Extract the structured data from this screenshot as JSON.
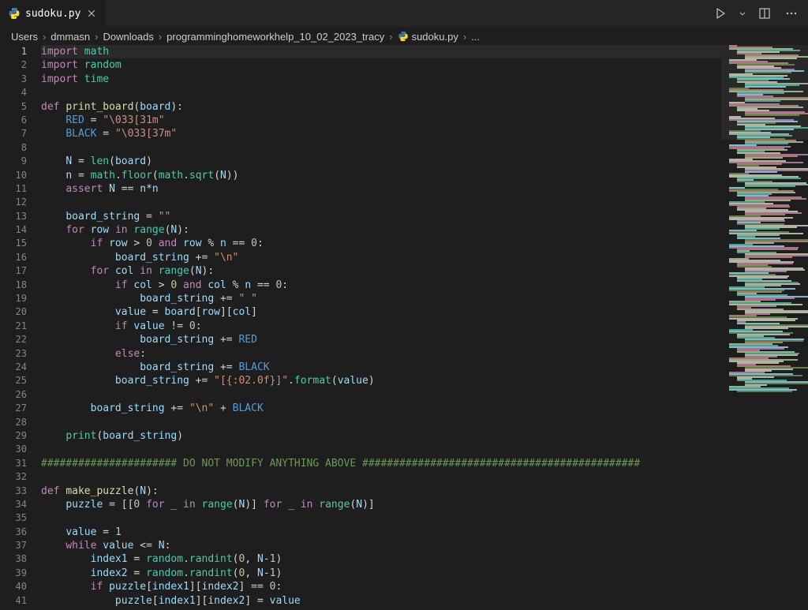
{
  "tab": {
    "filename": "sudoku.py",
    "icon": "python-icon"
  },
  "toolbar_right": {
    "run_icon": "run-icon",
    "run_dropdown_icon": "chevron-down-icon",
    "split_icon": "split-editor-icon",
    "more_icon": "more-icon"
  },
  "breadcrumb": {
    "items": [
      {
        "label": "Users"
      },
      {
        "label": "dmmasn"
      },
      {
        "label": "Downloads"
      },
      {
        "label": "programminghomeworkhelp_10_02_2023_tracy"
      },
      {
        "label": "sudoku.py",
        "icon": "python-icon"
      },
      {
        "label": "..."
      }
    ]
  },
  "editor": {
    "visible_line_start": 1,
    "visible_line_end": 41,
    "active_line": 1,
    "lines": [
      "import math",
      "import random",
      "import time",
      "",
      "def print_board(board):",
      "    RED = \"\\033[31m\"",
      "    BLACK = \"\\033[37m\"",
      "",
      "    N = len(board)",
      "    n = math.floor(math.sqrt(N))",
      "    assert N == n*n",
      "",
      "    board_string = \"\"",
      "    for row in range(N):",
      "        if row > 0 and row % n == 0:",
      "            board_string += \"\\n\"",
      "        for col in range(N):",
      "            if col > 0 and col % n == 0:",
      "                board_string += \" \"",
      "            value = board[row][col]",
      "            if value != 0:",
      "                board_string += RED",
      "            else:",
      "                board_string += BLACK",
      "            board_string += \"[{:02.0f}]\".format(value)",
      "",
      "        board_string += \"\\n\" + BLACK",
      "",
      "    print(board_string)",
      "",
      "###################### DO NOT MODIFY ANYTHING ABOVE #############################################",
      "",
      "def make_puzzle(N):",
      "    puzzle = [[0 for _ in range(N)] for _ in range(N)]",
      "",
      "    value = 1",
      "    while value <= N:",
      "        index1 = random.randint(0, N-1)",
      "        index2 = random.randint(0, N-1)",
      "        if puzzle[index1][index2] == 0:",
      "            puzzle[index1][index2] = value"
    ]
  },
  "chart_data": null
}
